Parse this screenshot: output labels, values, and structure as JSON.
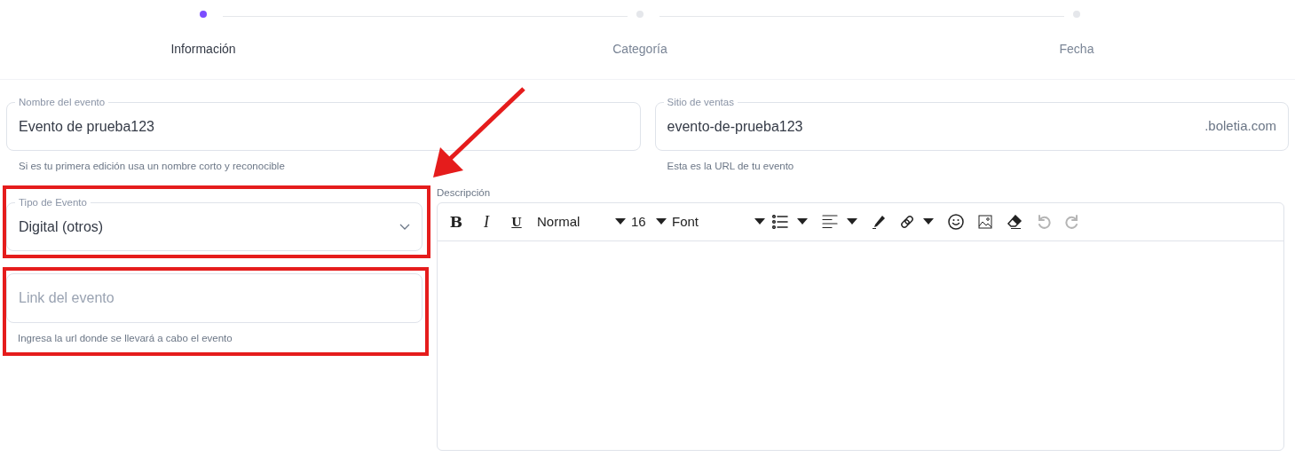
{
  "steps": [
    {
      "label": "Información",
      "selected": true
    },
    {
      "label": "Categoría",
      "selected": false
    },
    {
      "label": "Fecha",
      "selected": false
    }
  ],
  "event_name": {
    "label": "Nombre del evento",
    "value": "Evento de prueba123",
    "helper": "Si es tu primera edición usa un nombre corto y reconocible"
  },
  "sales_site": {
    "label": "Sitio de ventas",
    "value": "evento-de-prueba123",
    "suffix": ".boletia.com",
    "helper": "Esta es la URL de tu evento"
  },
  "event_type": {
    "label": "Tipo de Evento",
    "value": "Digital (otros)",
    "highlighted": true
  },
  "event_link": {
    "placeholder": "Link del evento",
    "helper": "Ingresa la url donde se llevará a cabo el evento",
    "highlighted": true
  },
  "description": {
    "label": "Descripción",
    "toolbar": [
      {
        "kind": "bold",
        "label": "B",
        "caret": false,
        "disabled": false
      },
      {
        "kind": "italic",
        "label": "I",
        "caret": false,
        "disabled": false
      },
      {
        "kind": "underline",
        "label": "U",
        "caret": false,
        "disabled": false
      },
      {
        "kind": "select",
        "label": "Normal",
        "caret": true,
        "disabled": false
      },
      {
        "kind": "select",
        "label": "16",
        "caret": true,
        "disabled": false
      },
      {
        "kind": "select",
        "label": "Font",
        "caret": true,
        "disabled": false
      },
      {
        "kind": "list",
        "caret": true,
        "disabled": false
      },
      {
        "kind": "align",
        "caret": true,
        "disabled": false
      },
      {
        "kind": "pen",
        "caret": false,
        "disabled": false
      },
      {
        "kind": "link",
        "caret": true,
        "disabled": false
      },
      {
        "kind": "emoji",
        "caret": false,
        "disabled": false
      },
      {
        "kind": "image",
        "caret": false,
        "disabled": false
      },
      {
        "kind": "eraser",
        "caret": false,
        "disabled": false
      },
      {
        "kind": "undo",
        "caret": false,
        "disabled": true
      },
      {
        "kind": "redo",
        "caret": false,
        "disabled": true
      }
    ]
  }
}
